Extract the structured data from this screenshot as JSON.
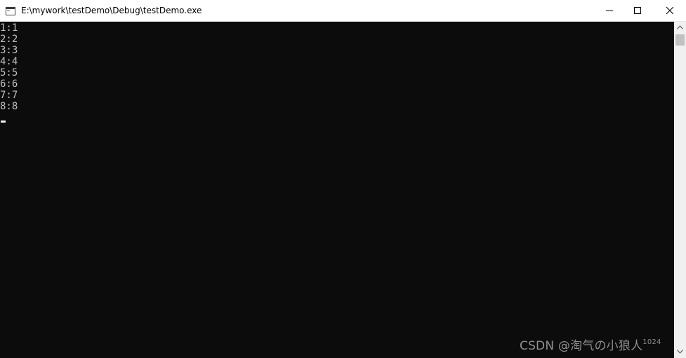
{
  "window": {
    "title": "E:\\mywork\\testDemo\\Debug\\testDemo.exe",
    "icon": "console-app-icon"
  },
  "caption_buttons": [
    {
      "name": "minimize",
      "icon": "minimize-icon"
    },
    {
      "name": "maximize",
      "icon": "maximize-icon"
    },
    {
      "name": "close",
      "icon": "close-icon"
    }
  ],
  "console": {
    "lines": [
      "1:1",
      "2:2",
      "3:3",
      "4:4",
      "5:5",
      "6:6",
      "7:7",
      "8:8"
    ],
    "text_color": "#c0c0c0",
    "background": "#0c0c0c"
  },
  "watermark": {
    "text": "CSDN @淘气の小狼人",
    "suffix": "1024"
  }
}
